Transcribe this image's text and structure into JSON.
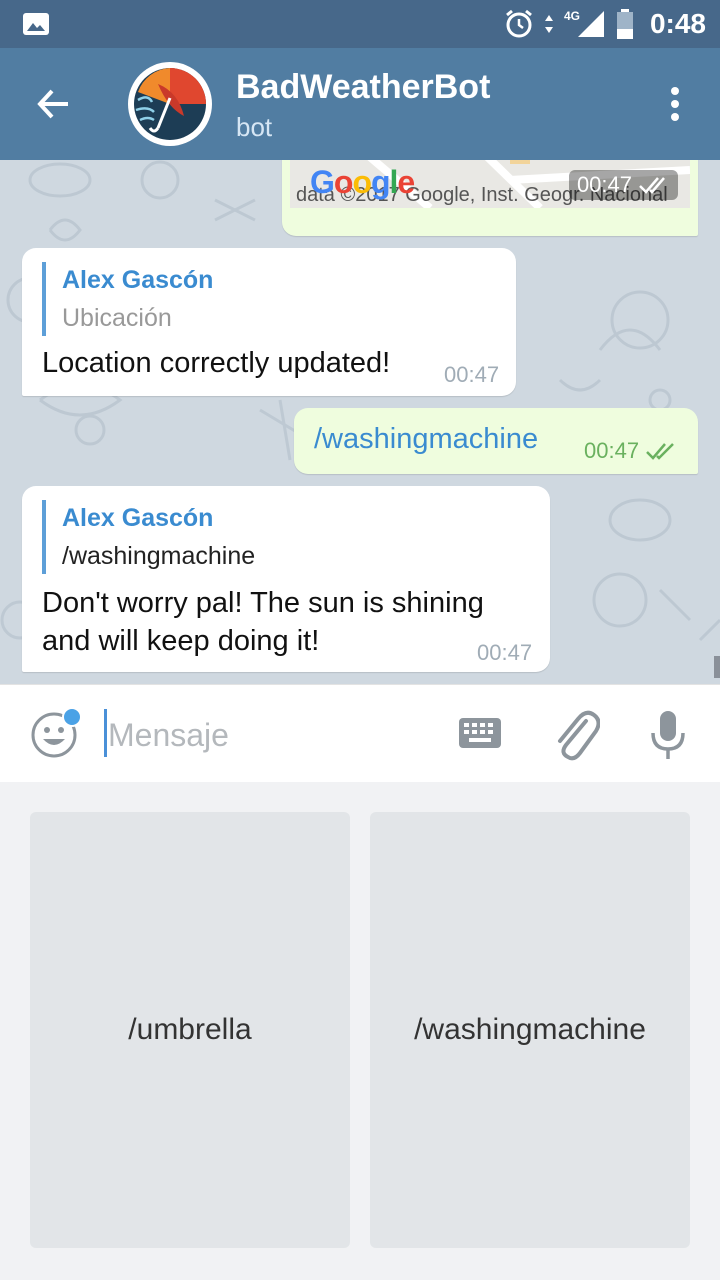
{
  "status_bar": {
    "time": "0:48",
    "network": "4G"
  },
  "header": {
    "title": "BadWeatherBot",
    "subtitle": "bot"
  },
  "messages": {
    "map": {
      "google_logo": "Google",
      "credit": "data ©2017 Google, Inst. Geogr. Nacional",
      "time": "00:47"
    },
    "msg1": {
      "reply_name": "Alex Gascón",
      "reply_text": "Ubicación",
      "text": "Location correctly updated!",
      "time": "00:47"
    },
    "msg2": {
      "text": "/washingmachine",
      "time": "00:47"
    },
    "msg3": {
      "reply_name": "Alex Gascón",
      "reply_text": "/washingmachine",
      "text_line1": "Don't worry pal! The sun is shining",
      "text_line2": "and will keep doing it!",
      "time": "00:47"
    }
  },
  "input": {
    "placeholder": "Mensaje",
    "value": ""
  },
  "keyboard": {
    "buttons": [
      {
        "label": "/umbrella"
      },
      {
        "label": "/washingmachine"
      }
    ]
  },
  "colors": {
    "status_bar": "#47688a",
    "header": "#517da2",
    "accent": "#3a8bd0",
    "outgoing_bubble": "#effdde",
    "check_green": "#6ab15f"
  }
}
